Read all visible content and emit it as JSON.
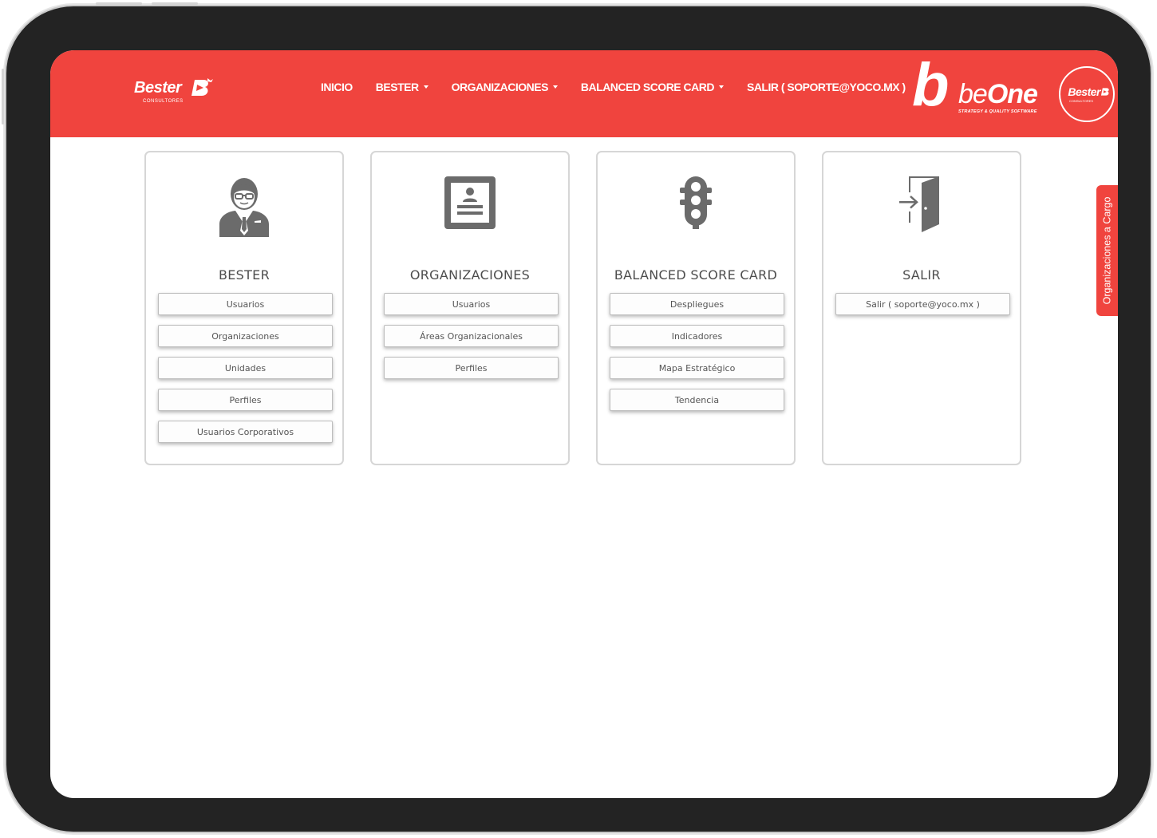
{
  "brand": {
    "bester_name": "Bester",
    "bester_sub": "CONSULTORES",
    "beone_name": "beOne",
    "beone_tagline": "STRATEGY & QUALITY SOFTWARE",
    "accent_color": "#f0443e"
  },
  "nav": {
    "items": [
      {
        "label": "INICIO",
        "has_caret": false
      },
      {
        "label": "BESTER",
        "has_caret": true
      },
      {
        "label": "ORGANIZACIONES",
        "has_caret": true
      },
      {
        "label": "BALANCED SCORE CARD",
        "has_caret": true
      },
      {
        "label": "SALIR ( SOPORTE@YOCO.MX )",
        "has_caret": false
      }
    ]
  },
  "cards": [
    {
      "title": "BESTER",
      "icon": "businessman-icon",
      "buttons": [
        "Usuarios",
        "Organizaciones",
        "Unidades",
        "Perfiles",
        "Usuarios Corporativos"
      ]
    },
    {
      "title": "ORGANIZACIONES",
      "icon": "id-card-icon",
      "buttons": [
        "Usuarios",
        "Áreas Organizacionales",
        "Perfiles"
      ]
    },
    {
      "title": "BALANCED SCORE CARD",
      "icon": "traffic-light-icon",
      "buttons": [
        "Despliegues",
        "Indicadores",
        "Mapa Estratégico",
        "Tendencia"
      ]
    },
    {
      "title": "SALIR",
      "icon": "exit-door-icon",
      "buttons": [
        "Salir ( soporte@yoco.mx )"
      ]
    }
  ],
  "side_tab": {
    "label": "Organizaciones a Cargo"
  }
}
